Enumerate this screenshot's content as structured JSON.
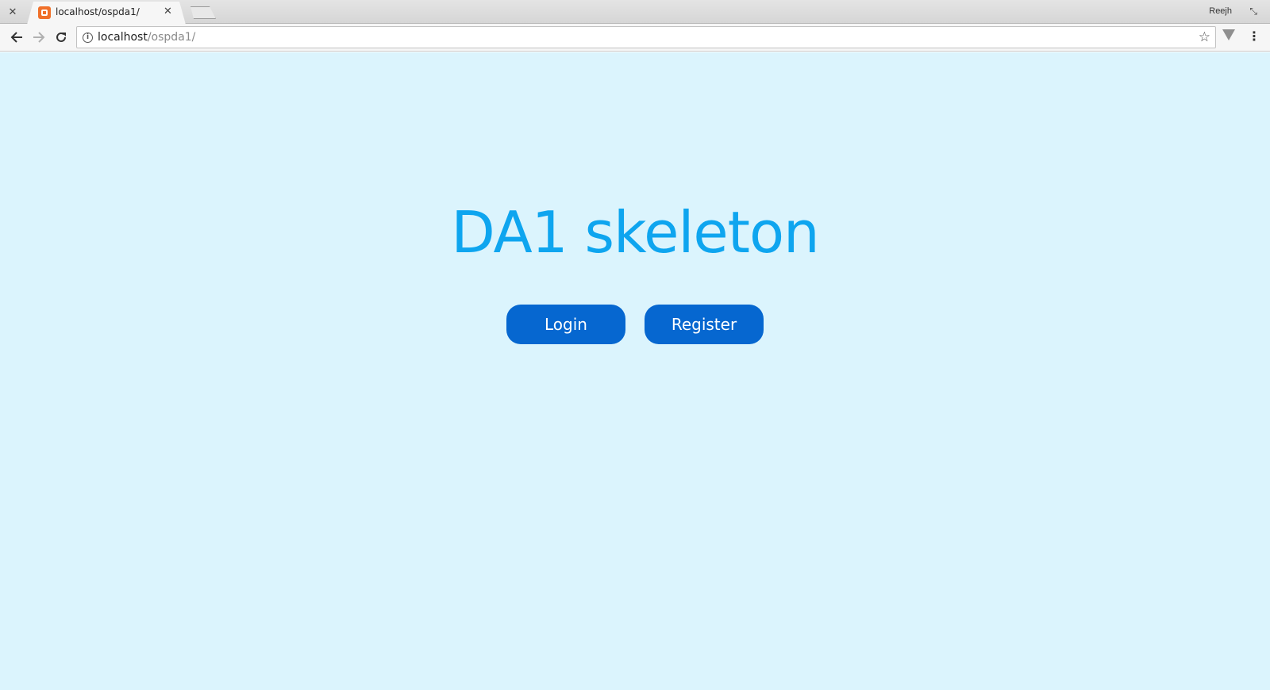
{
  "browser": {
    "tab": {
      "title": "localhost/ospda1/",
      "favicon": "xampp-icon"
    },
    "profile_name": "Reejh",
    "address_bar": {
      "host": "localhost",
      "path": "/ospda1/"
    }
  },
  "page": {
    "title": "DA1 skeleton",
    "buttons": {
      "login": "Login",
      "register": "Register"
    },
    "colors": {
      "background": "#dbf4fd",
      "title": "#0ea5ef",
      "button": "#0667d0"
    }
  }
}
